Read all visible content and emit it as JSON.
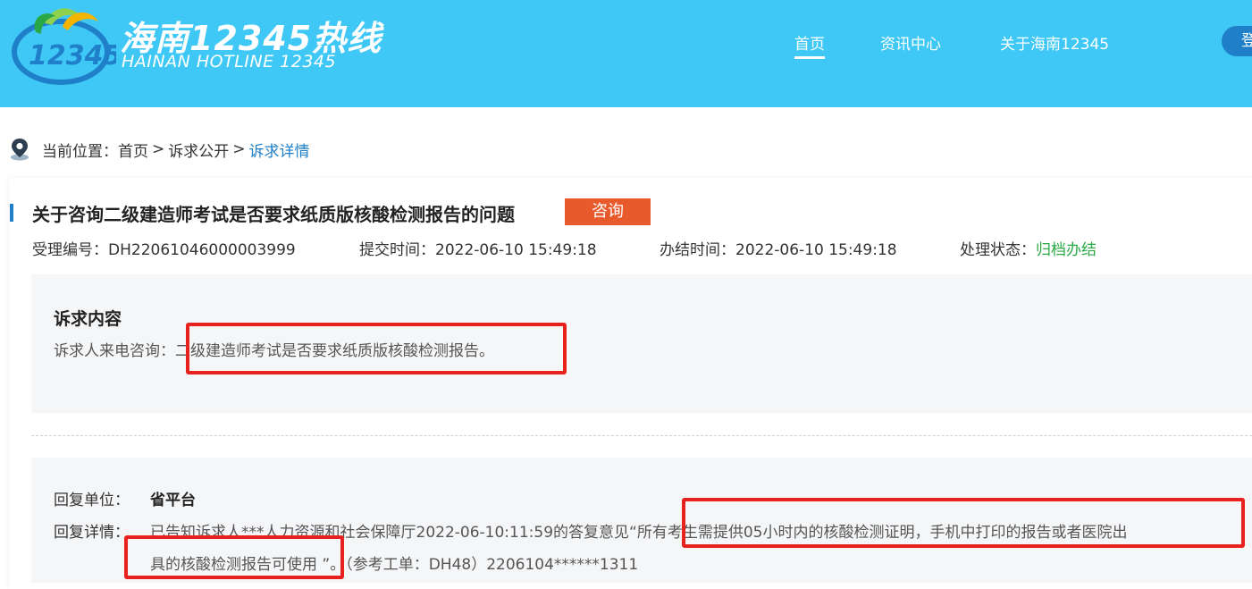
{
  "header": {
    "logo_cn": "海南12345热线",
    "logo_en": "HAINAN HOTLINE 12345",
    "logo_emblem_text": "12345",
    "nav": [
      {
        "label": "首页"
      },
      {
        "label": "资讯中心"
      },
      {
        "label": "关于海南12345"
      }
    ],
    "login_label": "登录"
  },
  "breadcrumb": {
    "prefix": "当前位置：",
    "items": [
      "首页",
      "诉求公开"
    ],
    "current": "诉求详情",
    "separator": ">"
  },
  "detail": {
    "title": "关于咨询二级建造师考试是否要求纸质版核酸检测报告的问题",
    "type_badge": "咨询",
    "accept_no_label": "受理编号：",
    "accept_no": "DH22061046000003999",
    "submit_time_label": "提交时间：",
    "submit_time": "2022-06-10 15:49:18",
    "finish_time_label": "办结时间：",
    "finish_time": "2022-06-10 15:49:18",
    "status_label": "处理状态：",
    "status": "归档办结"
  },
  "content": {
    "heading": "诉求内容",
    "text": "诉求人来电咨询：二级建造师考试是否要求纸质版核酸检测报告。"
  },
  "reply": {
    "unit_label": "回复单位：",
    "unit": "省平台",
    "detail_label": "回复详情：",
    "line1": "已告知诉求人***人力资源和社会保障厅2022-06-10:11:59的答复意见“所有考生需提供05小时内的核酸检测证明，手机中打印的报告或者医院出",
    "line2": "具的核酸检测报告可使用 ”。（参考工单：DH48）2206104******1311"
  },
  "colors": {
    "header_bg": "#3fc8f5",
    "accent_blue": "#1f7fc9",
    "badge_orange": "#e85a2c",
    "status_green": "#2aa845",
    "highlight_red": "#e8201e"
  }
}
